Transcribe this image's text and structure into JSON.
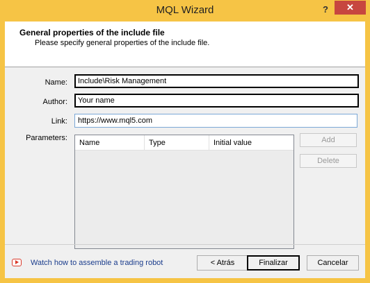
{
  "window": {
    "title": "MQL Wizard",
    "help_glyph": "?",
    "close_glyph": "✕"
  },
  "header": {
    "title": "General properties of the include file",
    "subtitle": "Please specify general properties of the include file."
  },
  "form": {
    "name_label": "Name:",
    "name_value": "Include\\Risk Management",
    "author_label": "Author:",
    "author_value": "Your name",
    "link_label": "Link:",
    "link_value": "https://www.mql5.com",
    "parameters_label": "Parameters:"
  },
  "parameters_table": {
    "columns": [
      "Name",
      "Type",
      "Initial value"
    ],
    "rows": []
  },
  "side_buttons": {
    "add": "Add",
    "delete": "Delete"
  },
  "footer": {
    "video_link": "Watch how to assemble a trading robot",
    "back": "< Atrás",
    "finish": "Finalizar",
    "cancel": "Cancelar"
  },
  "icons": {
    "video": "youtube-play-icon"
  }
}
